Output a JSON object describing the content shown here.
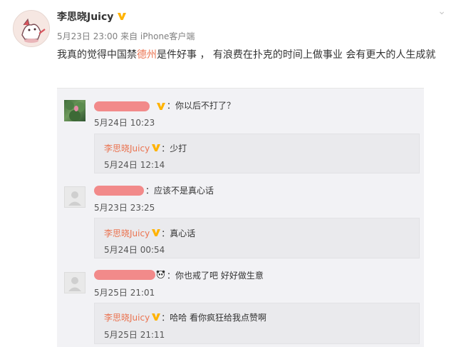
{
  "post": {
    "author": "李思晓Juicy",
    "meta": "5月23日 23:00 来自 iPhone客户端",
    "content_before": "我真的觉得中国禁",
    "content_highlight": "德州",
    "content_after": "是件好事 ， 有浪费在扑克的时间上做事业 会有更大的人生成就"
  },
  "comments": [
    {
      "text": "：你以后不打了？",
      "time": "5月24日 10:23",
      "reply": {
        "name": "李思晓Juicy",
        "text": "：少打",
        "time": "5月24日 12:14"
      }
    },
    {
      "text": "：应该不是真心话",
      "time": "5月23日 23:25",
      "reply": {
        "name": "李思晓Juicy",
        "text": "：真心话",
        "time": "5月24日 00:54"
      }
    },
    {
      "text": "：你也戒了吧 好好做生意",
      "time": "5月25日 21:01",
      "reply": {
        "name": "李思晓Juicy",
        "text": "：哈哈 看你疯狂给我点赞啊",
        "time": "5月25日 21:11"
      }
    }
  ],
  "colors": {
    "highlight": "#eb7350",
    "verified": "#ffb300",
    "redaction": "#f28a8a"
  }
}
